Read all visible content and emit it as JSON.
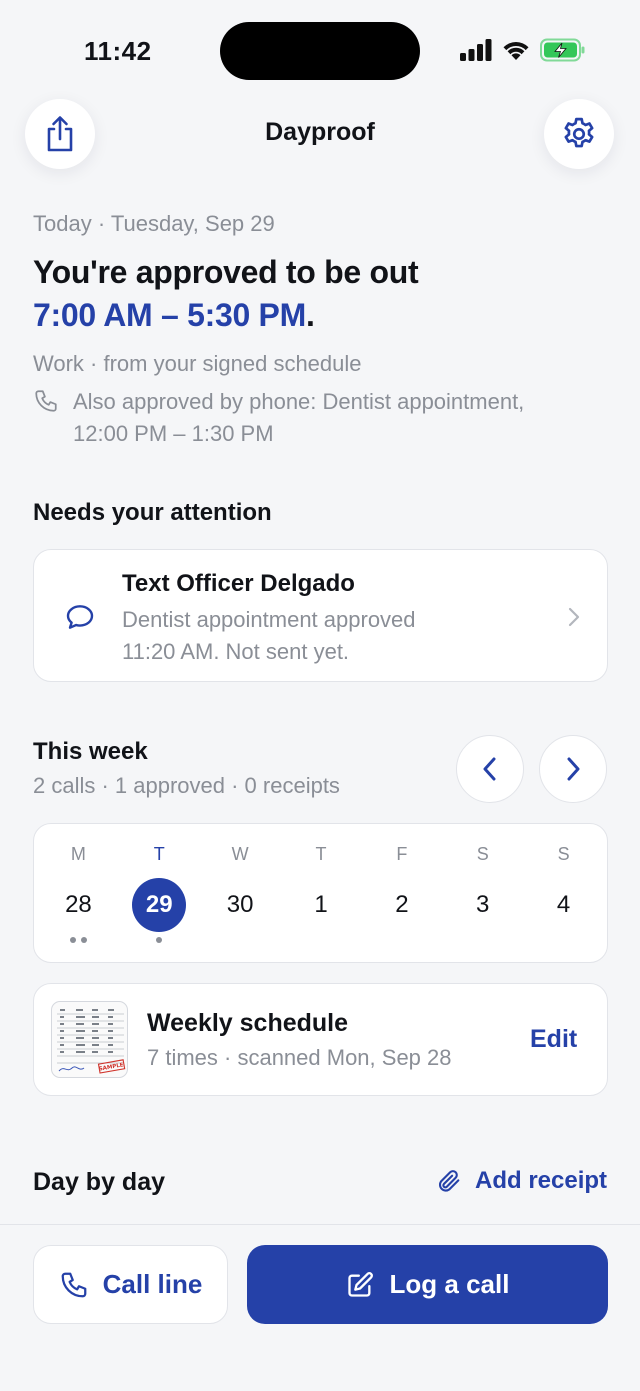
{
  "status_bar": {
    "time": "11:42"
  },
  "header": {
    "title": "Dayproof"
  },
  "today": {
    "date_line": "Today · Tuesday, Sep 29",
    "headline": "You're approved to be out",
    "time_range": "7:00 AM – 5:30 PM",
    "period": ".",
    "source": "Work · from your signed schedule",
    "phone_note_line1": "Also approved by phone: Dentist appointment,",
    "phone_note_line2": "12:00 PM – 1:30 PM"
  },
  "attention": {
    "heading": "Needs your attention",
    "item": {
      "title": "Text Officer Delgado",
      "line1": "Dentist appointment approved",
      "line2": "11:20 AM. Not sent yet."
    }
  },
  "week": {
    "heading": "This week",
    "summary": "2 calls · 1 approved · 0 receipts",
    "days": [
      {
        "letter": "M",
        "num": "28",
        "dots": 2
      },
      {
        "letter": "T",
        "num": "29",
        "dots": 1,
        "selected": true
      },
      {
        "letter": "W",
        "num": "30",
        "dots": 0
      },
      {
        "letter": "T",
        "num": "1",
        "dots": 0
      },
      {
        "letter": "F",
        "num": "2",
        "dots": 0
      },
      {
        "letter": "S",
        "num": "3",
        "dots": 0
      },
      {
        "letter": "S",
        "num": "4",
        "dots": 0
      }
    ]
  },
  "schedule": {
    "title": "Weekly schedule",
    "subtitle": "7 times · scanned Mon, Sep 28",
    "edit_label": "Edit",
    "thumb_stamp": "SAMPLE"
  },
  "day_by_day": {
    "heading": "Day by day",
    "add_receipt": "Add receipt"
  },
  "actions": {
    "call_line": "Call line",
    "log_call": "Log a call"
  },
  "colors": {
    "accent": "#2541a8",
    "background": "#f5f6f8",
    "muted_text": "#8a8e96",
    "battery": "#34c759"
  }
}
